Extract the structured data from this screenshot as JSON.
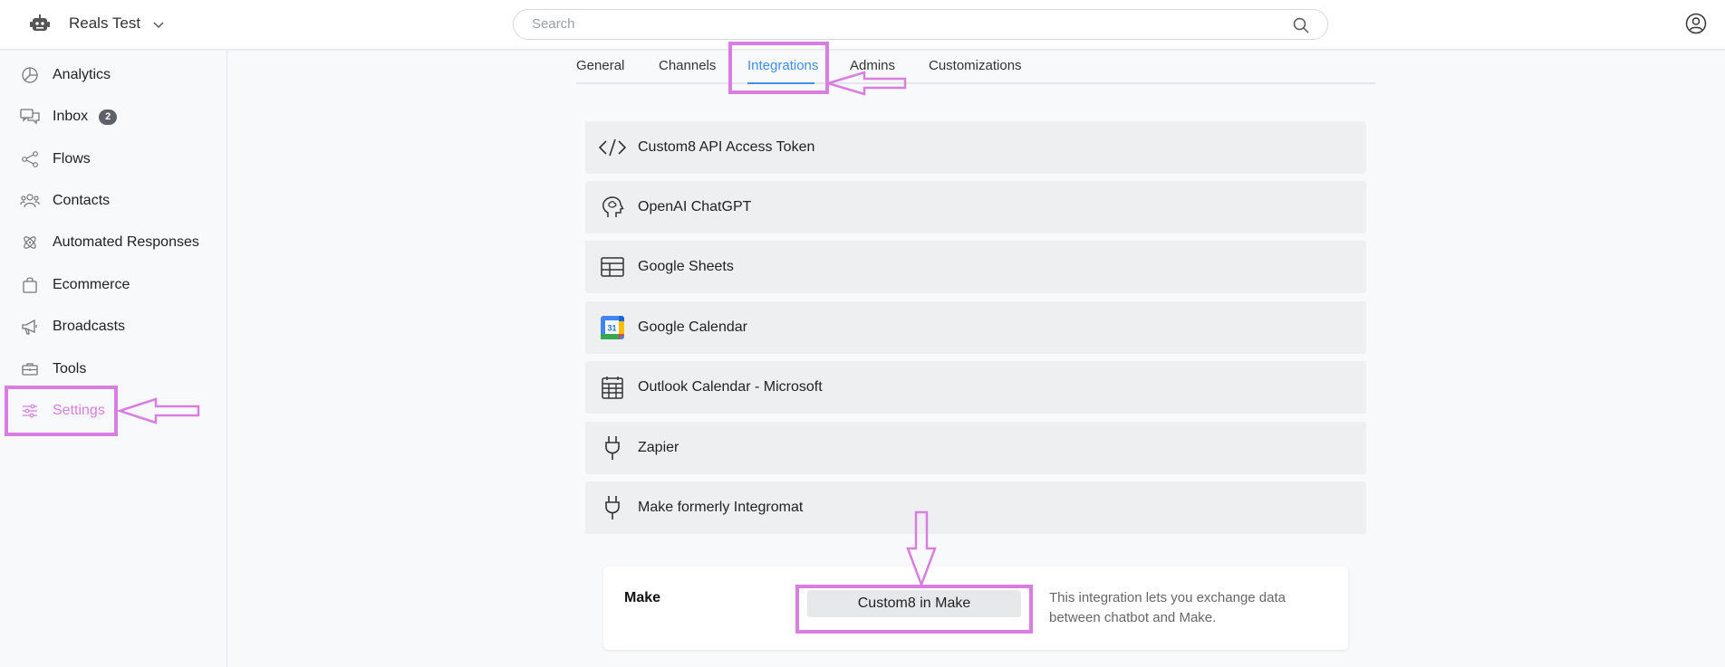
{
  "header": {
    "project_name": "Reals Test",
    "search_placeholder": "Search"
  },
  "sidebar": {
    "items": [
      {
        "label": "Analytics"
      },
      {
        "label": "Inbox",
        "badge": "2"
      },
      {
        "label": "Flows"
      },
      {
        "label": "Contacts"
      },
      {
        "label": "Automated Responses"
      },
      {
        "label": "Ecommerce"
      },
      {
        "label": "Broadcasts"
      },
      {
        "label": "Tools"
      },
      {
        "label": "Settings",
        "active": true
      }
    ]
  },
  "tabs": [
    {
      "label": "General"
    },
    {
      "label": "Channels"
    },
    {
      "label": "Integrations",
      "active": true
    },
    {
      "label": "Admins"
    },
    {
      "label": "Customizations"
    }
  ],
  "integrations": [
    {
      "label": "Custom8 API Access Token",
      "icon": "code-icon"
    },
    {
      "label": "OpenAI ChatGPT",
      "icon": "brain-head-icon"
    },
    {
      "label": "Google Sheets",
      "icon": "table-icon"
    },
    {
      "label": "Google Calendar",
      "icon": "google-calendar-icon"
    },
    {
      "label": "Outlook Calendar - Microsoft",
      "icon": "calendar-grid-icon"
    },
    {
      "label": "Zapier",
      "icon": "plug-icon"
    },
    {
      "label": "Make formerly Integromat",
      "icon": "plug-icon"
    }
  ],
  "make_card": {
    "title": "Make",
    "button_label": "Custom8 in Make",
    "description": "This integration lets you exchange data between chatbot and Make."
  },
  "calendar_icon_day": "31",
  "colors": {
    "accent": "#3f8ee8",
    "annotation": "#d77ee0",
    "active_nav": "#d77ee0"
  }
}
